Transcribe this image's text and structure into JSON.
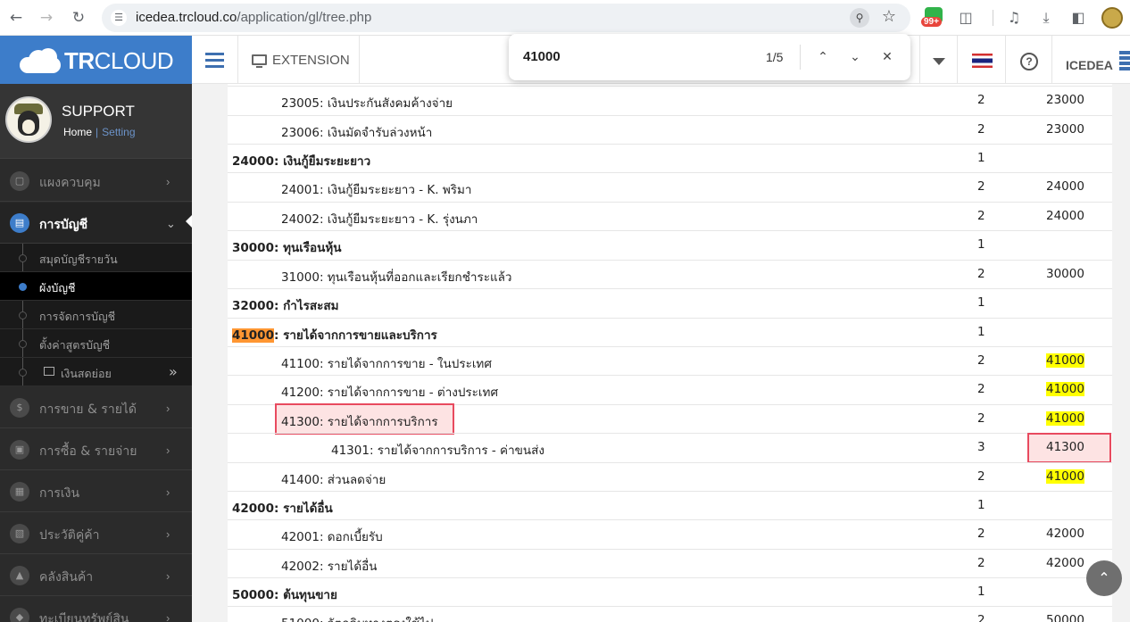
{
  "browser": {
    "url_host": "icedea.trcloud.co",
    "url_path": "/application/gl/tree.php",
    "ext_badge": "99+"
  },
  "find": {
    "query": "41000",
    "count": "1/5"
  },
  "header": {
    "logo_tr": "TR",
    "logo_cloud": "CLOUD",
    "extension_label": "EXTENSION",
    "user_label": "ICEDEA"
  },
  "profile": {
    "name": "SUPPORT",
    "home_link": "Home",
    "setting_link": "Setting"
  },
  "sidebar": {
    "dashboard": "แผงควบคุม",
    "accounting": "การบัญชี",
    "sub": [
      "สมุดบัญชีรายวัน",
      "ผังบัญชี",
      "การจัดการบัญชี",
      "ตั้งค่าสูตรบัญชี",
      "เงินสดย่อย"
    ],
    "sales": "การขาย & รายได้",
    "purchase": "การซื้อ & รายจ่าย",
    "finance": "การเงิน",
    "contacts": "ประวัติคู่ค้า",
    "inventory": "คลังสินค้า",
    "assets": "ทะเบียนทรัพย์สิน"
  },
  "accounts": [
    {
      "name": "23005: เงินประกันสังคมค้างจ่าย",
      "level": "2",
      "parent": "23000"
    },
    {
      "name": "23006: เงินมัดจำรับล่วงหน้า",
      "level": "2",
      "parent": "23000"
    },
    {
      "name": "24000: เงินกู้ยืมระยะยาว",
      "level": "1",
      "parent": ""
    },
    {
      "name": "24001: เงินกู้ยืมระยะยาว - K. พริมา",
      "level": "2",
      "parent": "24000"
    },
    {
      "name": "24002: เงินกู้ยืมระยะยาว - K. รุ่งนภา",
      "level": "2",
      "parent": "24000"
    },
    {
      "name": "30000: ทุนเรือนหุ้น",
      "level": "1",
      "parent": ""
    },
    {
      "name": "31000: ทุนเรือนหุ้นที่ออกและเรียกชำระแล้ว",
      "level": "2",
      "parent": "30000"
    },
    {
      "name": "32000: กำไรสะสม",
      "level": "1",
      "parent": ""
    },
    {
      "code": "41000",
      "title": ": รายได้จากการขายและบริการ",
      "level": "1",
      "parent": ""
    },
    {
      "name": "41100: รายได้จากการขาย - ในประเทศ",
      "level": "2",
      "parent": "41000"
    },
    {
      "name": "41200: รายได้จากการขาย - ต่างประเทศ",
      "level": "2",
      "parent": "41000"
    },
    {
      "name": "41300: รายได้จากการบริการ",
      "level": "2",
      "parent": "41000"
    },
    {
      "name": "41301: รายได้จากการบริการ - ค่าขนส่ง",
      "level": "3",
      "parent": "41300"
    },
    {
      "name": "41400: ส่วนลดจ่าย",
      "level": "2",
      "parent": "41000"
    },
    {
      "name": "42000: รายได้อื่น",
      "level": "1",
      "parent": ""
    },
    {
      "name": "42001: ดอกเบี้ยรับ",
      "level": "2",
      "parent": "42000"
    },
    {
      "name": "42002: รายได้อื่น",
      "level": "2",
      "parent": "42000"
    },
    {
      "name": "50000: ต้นทุนขาย",
      "level": "1",
      "parent": ""
    },
    {
      "name": "51000: วัตถุดิบทางตรงใช้ไป",
      "level": "2",
      "parent": "50000"
    }
  ]
}
